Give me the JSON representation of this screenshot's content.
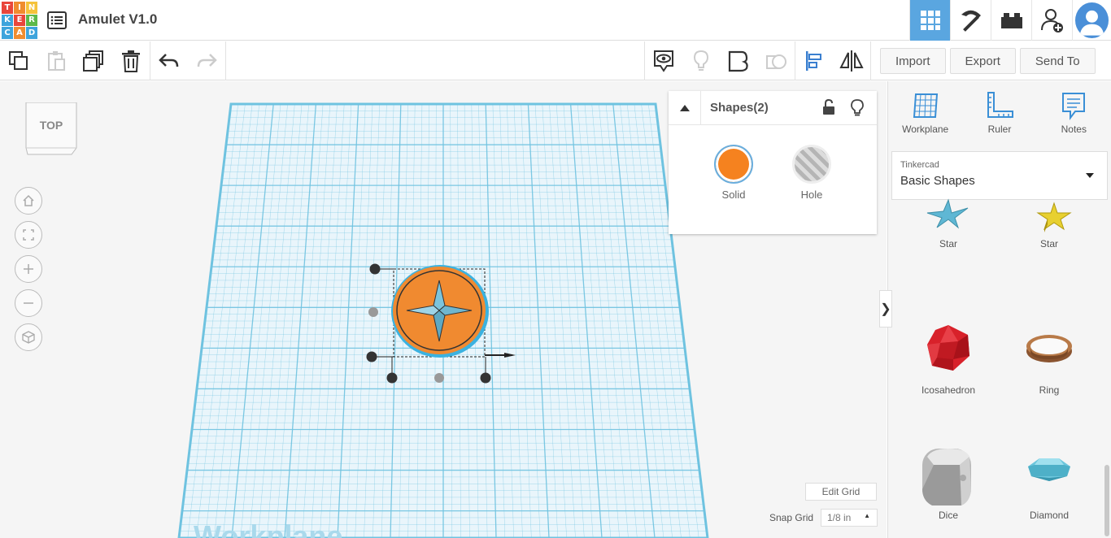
{
  "app": {
    "logo_letters": [
      "T",
      "I",
      "N",
      "K",
      "E",
      "R",
      "C",
      "A",
      "D"
    ],
    "logo_colors": [
      "#e9463b",
      "#f08c2f",
      "#f5c33b",
      "#3ea4dc",
      "#e9463b",
      "#5cb94a",
      "#3ea4dc",
      "#f08c2f",
      "#3ea4dc"
    ],
    "title": "Amulet V1.0"
  },
  "toolbar": {
    "import_label": "Import",
    "export_label": "Export",
    "send_to_label": "Send To"
  },
  "viewcube": {
    "face_label": "TOP"
  },
  "shapes_panel": {
    "title": "Shapes(2)",
    "solid_label": "Solid",
    "hole_label": "Hole",
    "solid_color": "#f5821f"
  },
  "canvas": {
    "workplane_watermark": "Workplane",
    "edit_grid_label": "Edit Grid",
    "snap_grid_label": "Snap Grid",
    "snap_grid_value": "1/8 in",
    "grid_color": "#6fc3e0"
  },
  "right_panel": {
    "tools": [
      {
        "label": "Workplane",
        "icon": "workplane-icon"
      },
      {
        "label": "Ruler",
        "icon": "ruler-icon"
      },
      {
        "label": "Notes",
        "icon": "notes-icon"
      }
    ],
    "library_category": "Tinkercad",
    "library_name": "Basic Shapes",
    "shapes": [
      {
        "label": "Star",
        "color": "#5fb7d4"
      },
      {
        "label": "Star",
        "color": "#e8d030"
      },
      {
        "label": "Icosahedron",
        "color": "#d8212a"
      },
      {
        "label": "Ring",
        "color": "#a0663a"
      },
      {
        "label": "Dice",
        "color": "#c8c8c8"
      },
      {
        "label": "Diamond",
        "color": "#6cc6dc"
      }
    ]
  }
}
